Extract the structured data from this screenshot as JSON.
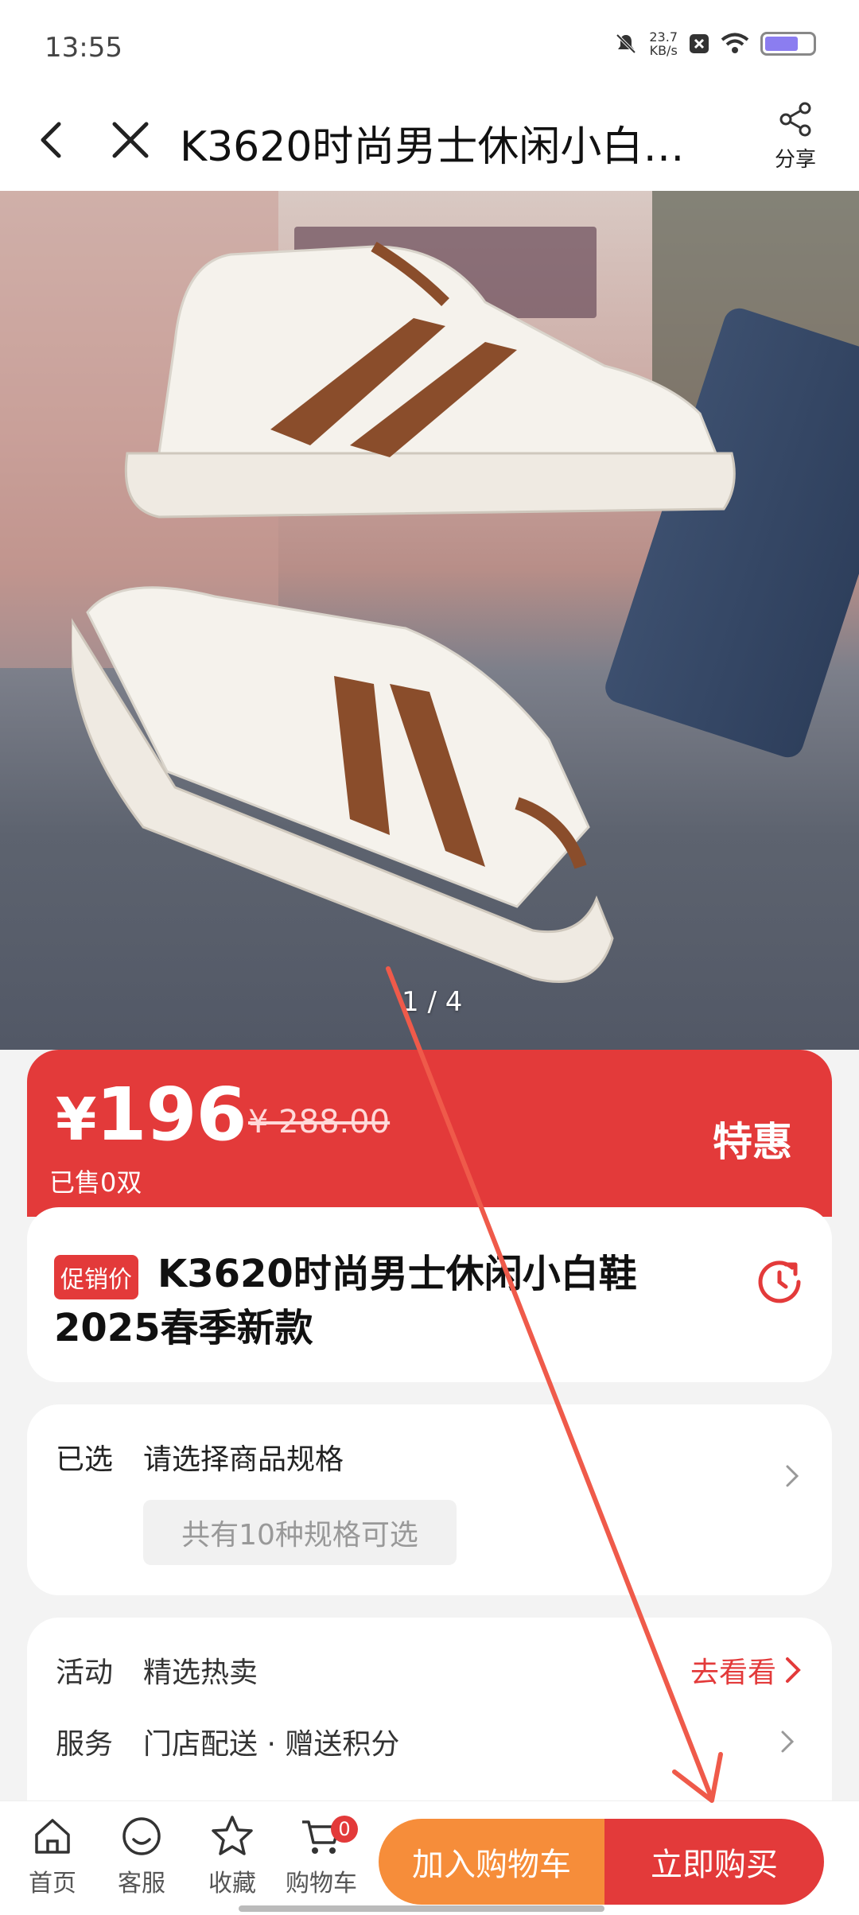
{
  "status_bar": {
    "time": "13:55",
    "net_speed_value": "23.7",
    "net_speed_unit": "KB/s",
    "icons": [
      "mute-icon",
      "notification-icon",
      "wifi-icon",
      "battery-icon"
    ]
  },
  "nav": {
    "title": "K3620时尚男士休闲小白鞋2025春季新款",
    "share_label": "分享",
    "icons": [
      "back-icon",
      "close-icon",
      "share-icon"
    ]
  },
  "gallery": {
    "indicator": "1 / 4"
  },
  "price": {
    "current_symbol": "¥",
    "current_value": "196",
    "original": "¥ 288.00",
    "sold": "已售0双",
    "tag": "特惠"
  },
  "product": {
    "badge": "促销价",
    "title": "K3620时尚男士休闲小白鞋2025春季新款"
  },
  "spec": {
    "label": "已选",
    "value": "请选择商品规格",
    "chip": "共有10种规格可选"
  },
  "activity": {
    "label": "活动",
    "value": "精选热卖",
    "link": "去看看"
  },
  "service": {
    "label": "服务",
    "value": "门店配送 · 赠送积分"
  },
  "bottom": {
    "tabs": [
      {
        "label": "首页",
        "icon": "home-icon"
      },
      {
        "label": "客服",
        "icon": "customer-service-icon"
      },
      {
        "label": "收藏",
        "icon": "star-icon"
      },
      {
        "label": "购物车",
        "icon": "cart-icon"
      }
    ],
    "cart_count": "0",
    "add_cart": "加入购物车",
    "buy_now": "立即购买"
  },
  "colors": {
    "accent_red": "#e33a3a",
    "accent_orange": "#f68d3a",
    "annotation_arrow": "#ef5a4a"
  }
}
